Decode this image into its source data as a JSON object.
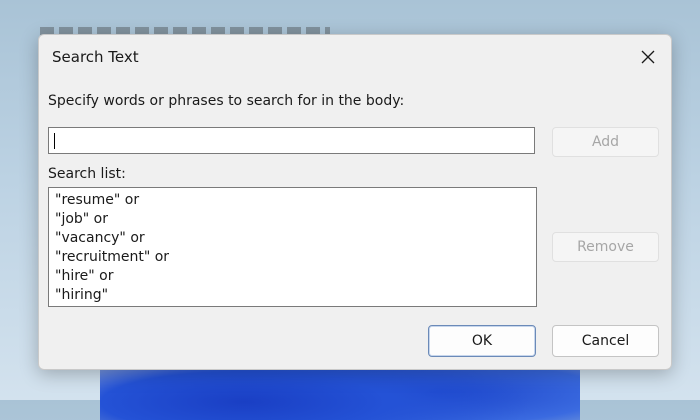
{
  "dialog": {
    "title": "Search Text",
    "close_icon": "close-icon",
    "instruction": "Specify words or phrases to search for in the body:",
    "search_input": {
      "value": "",
      "placeholder": ""
    },
    "add_label": "Add",
    "list_label": "Search list:",
    "search_list": [
      "\"resume\" or",
      "\"job\" or",
      "\"vacancy\" or",
      "\"recruitment\" or",
      "\"hire\" or",
      "\"hiring\""
    ],
    "remove_label": "Remove",
    "ok_label": "OK",
    "cancel_label": "Cancel"
  },
  "colors": {
    "dialog_bg": "#f0f0f0",
    "primary_button_border": "#6b8ab8",
    "disabled_text": "#a6a6a6"
  }
}
